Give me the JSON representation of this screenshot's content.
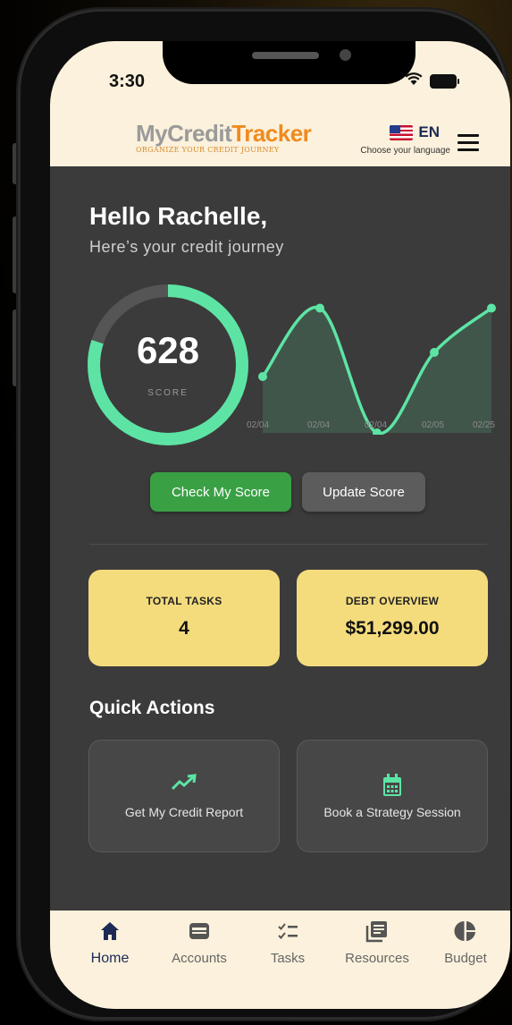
{
  "status": {
    "time": "3:30"
  },
  "header": {
    "logo_part1": "MyCredit",
    "logo_part2": "Tracker",
    "tagline": "ORGANIZE YOUR CREDIT JOURNEY",
    "language_code": "EN",
    "language_hint": "Choose your language"
  },
  "greeting": {
    "title": "Hello Rachelle,",
    "subtitle": "Here’s your credit journey"
  },
  "score": {
    "value": "628",
    "label": "SCORE",
    "fill_fraction": 0.8
  },
  "chart_data": {
    "type": "line",
    "x": [
      "02/04",
      "02/04",
      "02/04",
      "02/05",
      "02/25"
    ],
    "series": [
      {
        "values": [
          0.42,
          0.93,
          0.0,
          0.6,
          0.93
        ]
      }
    ],
    "color": "#5de4a4"
  },
  "buttons": {
    "check_score": "Check My Score",
    "update_score": "Update Score"
  },
  "cards": {
    "total_tasks_title": "TOTAL TASKS",
    "total_tasks_value": "4",
    "debt_title": "DEBT OVERVIEW",
    "debt_value": "$51,299.00"
  },
  "quick_actions": {
    "title": "Quick Actions",
    "items": [
      {
        "label": "Get My Credit Report",
        "icon": "trending-up-icon"
      },
      {
        "label": "Book a Strategy Session",
        "icon": "calendar-icon"
      }
    ]
  },
  "nav": {
    "items": [
      {
        "label": "Home",
        "icon": "home-icon"
      },
      {
        "label": "Accounts",
        "icon": "wallet-icon"
      },
      {
        "label": "Tasks",
        "icon": "checklist-icon"
      },
      {
        "label": "Resources",
        "icon": "library-icon"
      },
      {
        "label": "Budget",
        "icon": "pie-chart-icon"
      }
    ]
  },
  "colors": {
    "accent_green": "#5de4a4",
    "button_green": "#3aa044",
    "card_yellow": "#f4dc7d",
    "header_bg": "#fbf1dc",
    "navy": "#1c2a55"
  }
}
